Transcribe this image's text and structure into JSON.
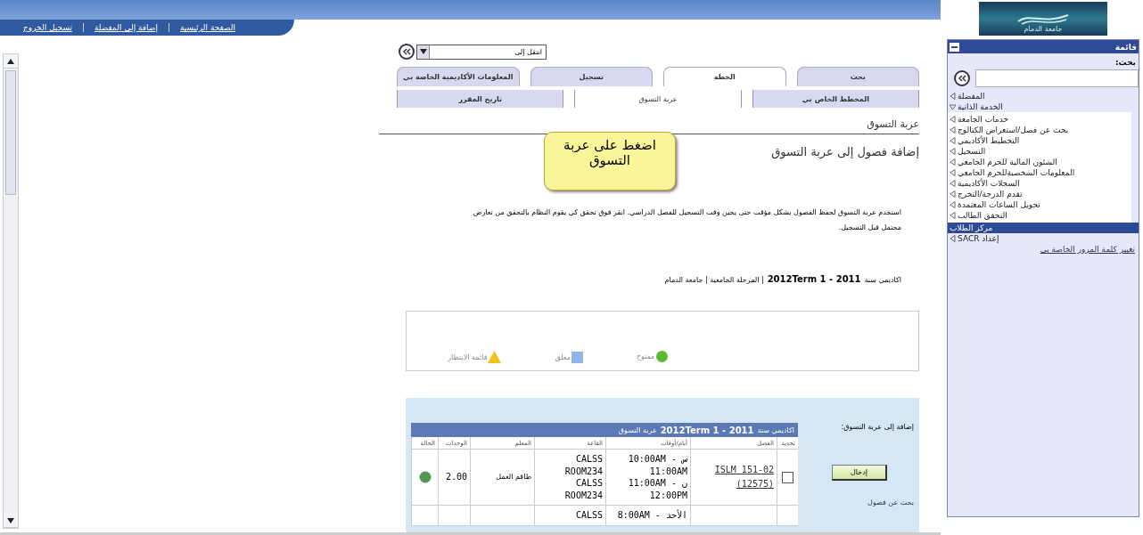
{
  "header_links": [
    "الصفحة الرئيسية",
    "إضافة إلى المفضلة",
    "تسجيل الخروج"
  ],
  "goto_select": {
    "value": "انتقل إلى"
  },
  "tabs": [
    {
      "label": "بحث",
      "selected": false
    },
    {
      "label": "الخطة",
      "selected": true
    },
    {
      "label": "تسجيل",
      "selected": false
    },
    {
      "label": "المعلومات الأكاديمية الخاصة بي",
      "selected": false
    }
  ],
  "subtabs": [
    {
      "label": "المخطط الخاص بي",
      "selected": false
    },
    {
      "label": "عربة التسوق",
      "selected": true
    },
    {
      "label": "تاريخ المقرر",
      "selected": false
    }
  ],
  "callout": "اضغط على عربة التسوق",
  "page_title": "عربة التسوق",
  "heading": "إضافة فصول إلى عربة التسوق",
  "instructions": "استخدم عربة التسوق لحفظ الفصول بشكل مؤقت حتى يحين وقت التسجيل للفصل الدراسي.  انقر فوق تحقق كي يقوم النظام بالتحقق من تعارض محتمل قبل التسجيل.",
  "term_line": {
    "label": "اكاديمي سنة",
    "term": "2012Term 1 - 2011",
    "rest": "| المرحلة الجامعية | جامعة الدمام"
  },
  "legend": [
    {
      "kind": "circle",
      "label": "مفتوح",
      "color": "#5cb82e"
    },
    {
      "kind": "square",
      "label": "مغلق",
      "color": "#8fb4e8"
    },
    {
      "kind": "triangle",
      "label": "قائمة الانتظار",
      "color": "#f2c21a"
    }
  ],
  "add_panel": {
    "label": "إضافة إلى عربة التسوق:",
    "button": "إدخال",
    "search_link": "بحث عن فصول"
  },
  "cart_table": {
    "title_label": "اكاديمي سنة",
    "title_term": "2012Term 1 - 2011",
    "title_rest": "عربة التسوق",
    "columns": [
      "تحديد",
      "الفصل",
      "أيام/أوقات",
      "القاعة",
      "المعلم",
      "الوحدات",
      "الحالة"
    ],
    "rows": [
      {
        "checked": false,
        "class": "ISLM 151-02 (12575)",
        "times": [
          "س - 10:00AM",
          "11:00AM",
          "ن - 11:00AM",
          "12:00PM"
        ],
        "rooms": [
          "CALSS",
          "ROOM234",
          "CALSS",
          "ROOM234"
        ],
        "instructor": "طاقم العمل",
        "units": "2.00",
        "color": "#4f9a50"
      },
      {
        "times": [
          "الأحد - 8:00AM"
        ],
        "rooms": [
          "CALSS"
        ]
      }
    ]
  },
  "sidebar": {
    "title": "قائمة",
    "search_label": "بحث:",
    "items": [
      {
        "label": "المفضلة",
        "expanded": false,
        "selected": false
      },
      {
        "label": "الخدمة الذاتية",
        "expanded": true,
        "selected": false,
        "children": [
          {
            "label": "خدمات الجامعة"
          },
          {
            "label": "بحث عن فصل/استعراض الكتالوج"
          },
          {
            "label": "التخطيط الأكاديمي"
          },
          {
            "label": "التسجيل"
          },
          {
            "label": "الشئون المالية للحرم الجامعي"
          },
          {
            "label": "المعلومات الشخصيةللحرم الجامعي"
          },
          {
            "label": "السجلات الأكاديمية"
          },
          {
            "label": "تقدم الدرجة/التخرج"
          },
          {
            "label": "تحويل الساعات المعتمدة"
          },
          {
            "label": "التحقق الطالب"
          }
        ]
      },
      {
        "label": "مركز الطلاب",
        "expanded": false,
        "selected": true
      },
      {
        "label": "إعداد SACR",
        "expanded": false,
        "selected": false
      }
    ],
    "link": "تغيير كلمة المرور الخاصة بي"
  },
  "logo_text": "جامعة الدمام"
}
